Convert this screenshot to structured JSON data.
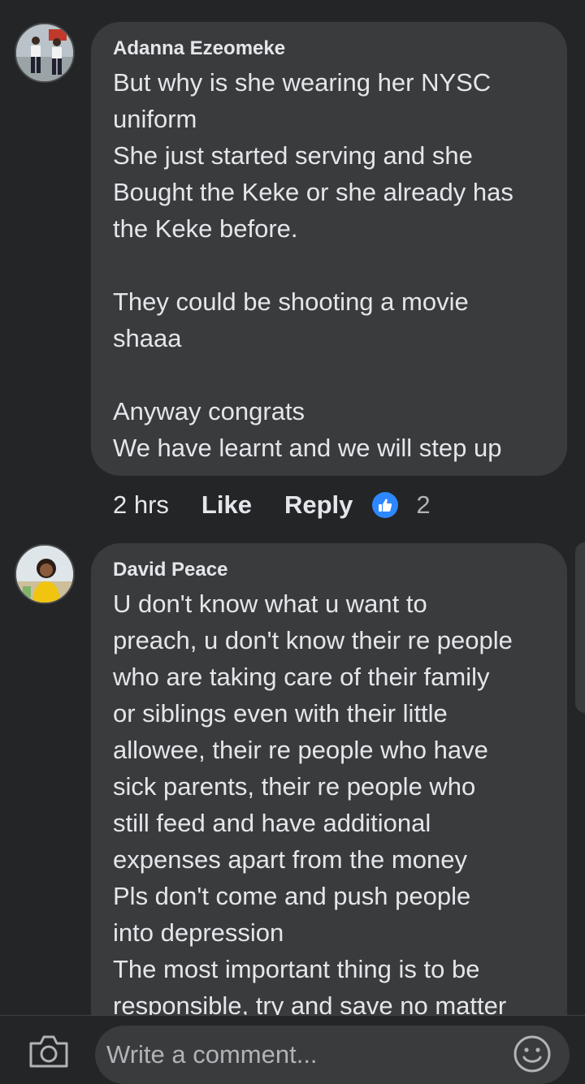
{
  "comments": [
    {
      "author": "Adanna Ezeomeke",
      "text": "But why is she wearing her NYSC\nuniform\nShe just started serving and she\nBought the Keke or she already has\nthe Keke before.\n\nThey could be shooting a movie\nshaaa\n\nAnyway congrats\nWe have learnt and we will step up",
      "time": "2 hrs",
      "like_label": "Like",
      "reply_label": "Reply",
      "reaction_count": "2"
    },
    {
      "author": "David Peace",
      "text": "U don't know what u want to\npreach, u don't know their re people\nwho are taking care of their family\nor siblings even with their little\nallowee, their re people who have\nsick parents, their re people who\nstill feed and have additional\nexpenses apart from the money\nPls don't come and push people\ninto depression\nThe most important thing is to be\nresponsible, try and save no matter"
    }
  ],
  "composer": {
    "placeholder": "Write a comment...",
    "camera_icon": "camera-icon",
    "emoji_icon": "emoji-icon"
  },
  "colors": {
    "background": "#242526",
    "bubble": "#3a3b3c",
    "like_blue": "#2d88ff"
  }
}
